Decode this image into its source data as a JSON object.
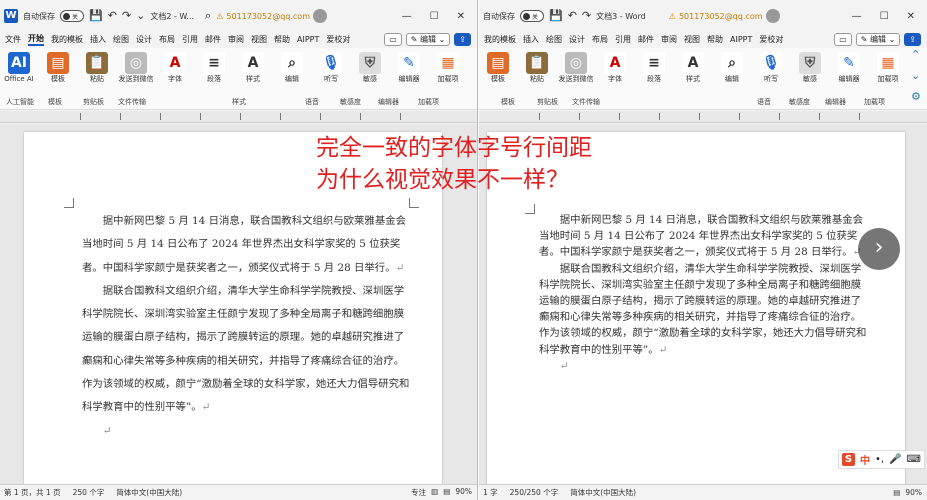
{
  "left": {
    "autosave_label": "自动保存",
    "autosave_state": "关",
    "doc_title": "文档2 - W...",
    "account": "501173052@qq.com",
    "menu": [
      "文件",
      "开始",
      "我的模板",
      "插入",
      "绘图",
      "设计",
      "布局",
      "引用",
      "邮件",
      "审阅",
      "视图",
      "帮助",
      "AIPPT",
      "爱校对"
    ],
    "edit_button": "编辑",
    "ribbon": [
      "Office AI",
      "模板",
      "粘贴",
      "发送到微信",
      "字体",
      "段落",
      "样式",
      "编辑",
      "听写",
      "敏感",
      "编辑器",
      "加载项"
    ],
    "groups": [
      "人工智能",
      "模板",
      "剪贴板",
      "文件传输",
      "样式",
      "语音",
      "敏感度",
      "编辑器",
      "加载项"
    ],
    "paragraphs": [
      "据中新网巴黎 5 月 14 日消息，联合国教科文组织与欧莱雅基金会当地时间 5 月 14 日公布了 2024 年世界杰出女科学家奖的 5 位获奖者。中国科学家颜宁是获奖者之一，颁奖仪式将于 5 月 28 日举行。",
      "据联合国教科文组织介绍，清华大学生命科学学院教授、深圳医学科学院院长、深圳湾实验室主任颜宁发现了多种全局离子和糖跨细胞膜运输的膜蛋白原子结构，揭示了跨膜转运的原理。她的卓越研究推进了癫痫和心律失常等多种疾病的相关研究，并指导了疼痛综合征的治疗。作为该领域的权威，颜宁“激励着全球的女科学家，她还大力倡导研究和科学教育中的性别平等”。"
    ],
    "status": {
      "page": "第 1 页，共 1 页",
      "words": "250 个字",
      "lang": "简体中文(中国大陆)",
      "focus": "专注",
      "zoom": "90%"
    }
  },
  "right": {
    "autosave_label": "自动保存",
    "autosave_state": "关",
    "doc_title": "文档3 - Word",
    "account": "501173052@qq.com",
    "menu": [
      "我的模板",
      "插入",
      "绘图",
      "设计",
      "布局",
      "引用",
      "邮件",
      "审阅",
      "视图",
      "帮助",
      "AIPPT",
      "爱校对"
    ],
    "edit_button": "编辑",
    "ribbon": [
      "模板",
      "粘贴",
      "发送到微信",
      "字体",
      "段落",
      "样式",
      "编辑",
      "听写",
      "敏感",
      "编辑器",
      "加载项"
    ],
    "groups": [
      "模板",
      "剪贴板",
      "文件传输",
      "语音",
      "敏感度",
      "编辑器",
      "加载项"
    ],
    "paragraphs": [
      "据中新网巴黎 5 月 14 日消息，联合国教科文组织与欧莱雅基金会当地时间 5 月 14 日公布了 2024 年世界杰出女科学家奖的 5 位获奖者。中国科学家颜宁是获奖者之一，颁奖仪式将于 5 月 28 日举行。",
      "据联合国教科文组织介绍，清华大学生命科学学院教授、深圳医学科学院院长、深圳湾实验室主任颜宁发现了多种全局离子和糖跨细胞膜运输的膜蛋白原子结构，揭示了跨膜转运的原理。她的卓越研究推进了癫痫和心律失常等多种疾病的相关研究，并指导了疼痛综合征的治疗。作为该领域的权威，颜宁“激励着全球的女科学家，她还大力倡导研究和科学教育中的性别平等”。"
    ],
    "status": {
      "page": "1 字",
      "words": "250/250 个字",
      "lang": "简体中文(中国大陆)",
      "zoom": "90%"
    }
  },
  "overlay": {
    "line1": "完全一致的字体字号行间距",
    "line2": "为什么视觉效果不一样？"
  },
  "ime": {
    "s": "S",
    "zh": "中"
  },
  "next_icon": "›",
  "colors": {
    "word_blue": "#185abd",
    "overlay_red": "#e02020"
  }
}
